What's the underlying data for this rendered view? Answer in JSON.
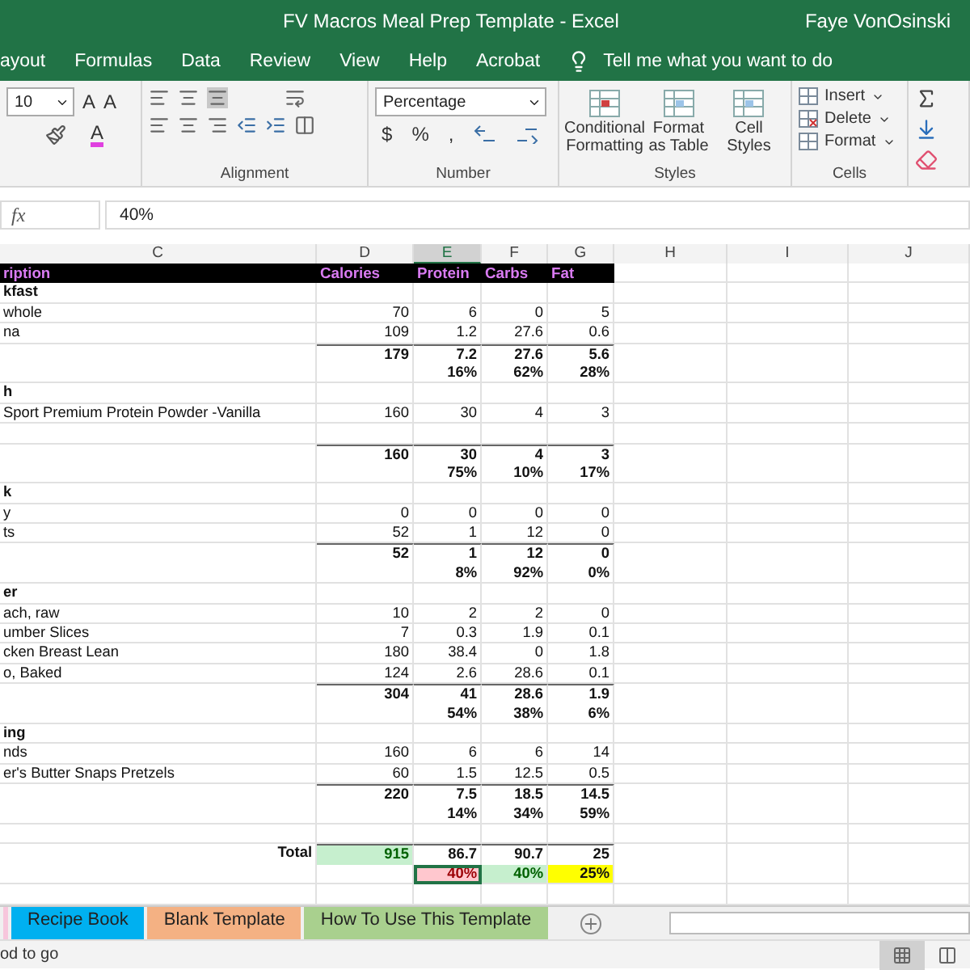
{
  "window": {
    "title": "FV Macros Meal Prep Template  -  Excel",
    "user": "Faye VonOsinski"
  },
  "menu": [
    "ayout",
    "Formulas",
    "Data",
    "Review",
    "View",
    "Help",
    "Acrobat"
  ],
  "tell_me": "Tell me what you want to do",
  "ribbon": {
    "font_size": "10",
    "font_glyphs": [
      "A",
      "A",
      "A"
    ],
    "number_format": "Percentage",
    "number_symbols": [
      "$",
      "%",
      ","
    ],
    "group_labels": [
      "Alignment",
      "Number",
      "Styles",
      "Cells"
    ],
    "styles_buttons": [
      "Conditional Formatting",
      "Format as Table",
      "Cell Styles"
    ],
    "cells_buttons": [
      "Insert",
      "Delete",
      "Format"
    ]
  },
  "formula_bar": {
    "fx": "fx",
    "value": "40%"
  },
  "columns": [
    {
      "label": "C",
      "selected": false
    },
    {
      "label": "D",
      "selected": false
    },
    {
      "label": "E",
      "selected": true
    },
    {
      "label": "F",
      "selected": false
    },
    {
      "label": "G",
      "selected": false
    },
    {
      "label": "H",
      "selected": false
    },
    {
      "label": "I",
      "selected": false
    },
    {
      "label": "J",
      "selected": false
    }
  ],
  "rows": [
    {
      "kind": "header",
      "cells": [
        "ription",
        "Calories",
        "Protein",
        "Carbs",
        "Fat"
      ]
    },
    {
      "kind": "section",
      "label": "kfast"
    },
    {
      "kind": "item",
      "label": "whole",
      "values": [
        "70",
        "6",
        "0",
        "5"
      ]
    },
    {
      "kind": "item",
      "label": "na",
      "values": [
        "109",
        "1.2",
        "27.6",
        "0.6"
      ]
    },
    {
      "kind": "total",
      "values": [
        "179",
        "7.2",
        "27.6",
        "5.6"
      ]
    },
    {
      "kind": "pct",
      "values": [
        "16%",
        "62%",
        "28%"
      ]
    },
    {
      "kind": "section",
      "label": "h"
    },
    {
      "kind": "item",
      "label": "Sport Premium Protein Powder -Vanilla",
      "values": [
        "160",
        "30",
        "4",
        "3"
      ]
    },
    {
      "kind": "blank"
    },
    {
      "kind": "total",
      "values": [
        "160",
        "30",
        "4",
        "3"
      ]
    },
    {
      "kind": "pct",
      "values": [
        "75%",
        "10%",
        "17%"
      ]
    },
    {
      "kind": "section",
      "label": "k"
    },
    {
      "kind": "item",
      "label": "y",
      "values": [
        "0",
        "0",
        "0",
        "0"
      ]
    },
    {
      "kind": "item",
      "label": "ts",
      "values": [
        "52",
        "1",
        "12",
        "0"
      ]
    },
    {
      "kind": "total",
      "values": [
        "52",
        "1",
        "12",
        "0"
      ]
    },
    {
      "kind": "pct",
      "values": [
        "8%",
        "92%",
        "0%"
      ]
    },
    {
      "kind": "section",
      "label": "er"
    },
    {
      "kind": "item",
      "label": "ach, raw",
      "values": [
        "10",
        "2",
        "2",
        "0"
      ]
    },
    {
      "kind": "item",
      "label": "umber Slices",
      "values": [
        "7",
        "0.3",
        "1.9",
        "0.1"
      ]
    },
    {
      "kind": "item",
      "label": "cken Breast Lean",
      "values": [
        "180",
        "38.4",
        "0",
        "1.8"
      ]
    },
    {
      "kind": "item",
      "label": "o, Baked",
      "values": [
        "124",
        "2.6",
        "28.6",
        "0.1"
      ]
    },
    {
      "kind": "total",
      "values": [
        "304",
        "41",
        "28.6",
        "1.9"
      ]
    },
    {
      "kind": "pct",
      "values": [
        "54%",
        "38%",
        "6%"
      ]
    },
    {
      "kind": "section",
      "label": "ing"
    },
    {
      "kind": "item",
      "label": "nds",
      "values": [
        "160",
        "6",
        "6",
        "14"
      ]
    },
    {
      "kind": "item",
      "label": "er's Butter Snaps Pretzels",
      "values": [
        "60",
        "1.5",
        "12.5",
        "0.5"
      ]
    },
    {
      "kind": "total",
      "values": [
        "220",
        "7.5",
        "18.5",
        "14.5"
      ]
    },
    {
      "kind": "pct",
      "values": [
        "14%",
        "34%",
        "59%"
      ]
    },
    {
      "kind": "blank"
    },
    {
      "kind": "grand",
      "label": "Total",
      "cells": [
        {
          "text": "915",
          "color": "#c6efce"
        },
        {
          "text": "86.7"
        },
        {
          "text": "90.7"
        },
        {
          "text": "25"
        }
      ]
    },
    {
      "kind": "grandpct",
      "cells": [
        {
          "text": "40%",
          "color": "#ffc7ce",
          "selected": true
        },
        {
          "text": "40%",
          "color": "#c6efce",
          "selected": false
        },
        {
          "text": "25%",
          "color": "#ffff00",
          "selected": false
        }
      ]
    },
    {
      "kind": "blank"
    }
  ],
  "sheet_tabs": [
    {
      "label": "Recipe Book",
      "color": "#00b0f0"
    },
    {
      "label": "Blank Template",
      "color": "#f4b183"
    },
    {
      "label": "How To Use This Template",
      "color": "#a9d08e"
    }
  ],
  "status": "od to go"
}
